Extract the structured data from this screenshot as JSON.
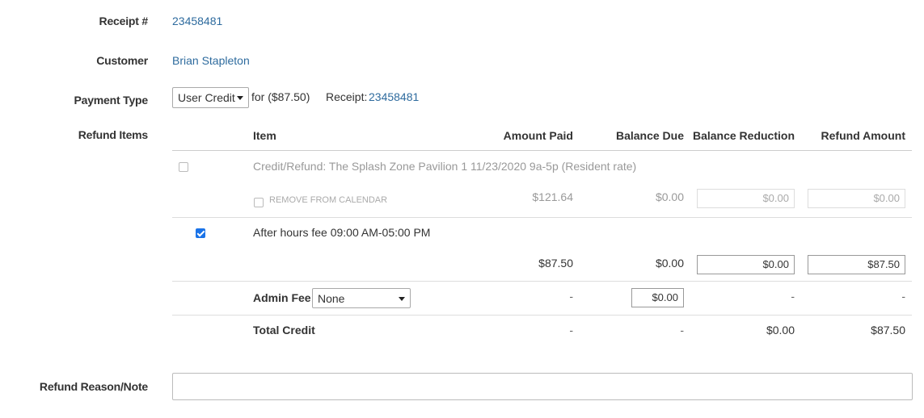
{
  "receipt": {
    "label": "Receipt #",
    "value": "23458481"
  },
  "customer": {
    "label": "Customer",
    "value": "Brian Stapleton"
  },
  "payment": {
    "label": "Payment Type",
    "type_selected": "User Credit",
    "for_text": "for ($87.50)",
    "receipt_label": "Receipt:",
    "receipt_link": "23458481"
  },
  "refund_items": {
    "label": "Refund Items",
    "columns": {
      "item": "Item",
      "amount_paid": "Amount Paid",
      "balance_due": "Balance Due",
      "balance_reduction": "Balance Reduction",
      "refund_amount": "Refund Amount"
    },
    "rows": [
      {
        "checked": false,
        "enabled": false,
        "name": "Credit/Refund: The Splash Zone Pavilion 1 11/23/2020 9a-5p (Resident rate)",
        "remove_label": "REMOVE FROM CALENDAR",
        "amount_paid": "$121.64",
        "balance_due": "$0.00",
        "balance_reduction": "$0.00",
        "refund_amount": "$0.00"
      },
      {
        "checked": true,
        "enabled": true,
        "name": "After hours fee 09:00 AM-05:00 PM",
        "amount_paid": "$87.50",
        "balance_due": "$0.00",
        "balance_reduction": "$0.00",
        "refund_amount": "$87.50"
      }
    ],
    "admin_fee": {
      "label": "Admin Fee:",
      "selected": "None",
      "amount_paid": "-",
      "balance_due": "$0.00",
      "balance_reduction": "-",
      "refund_amount": "-"
    },
    "total": {
      "label": "Total Credit",
      "amount_paid": "-",
      "balance_due": "-",
      "balance_reduction": "$0.00",
      "refund_amount": "$87.50"
    }
  },
  "refund_note": {
    "label": "Refund Reason/Note",
    "value": ""
  },
  "colors": {
    "link": "#2e6b9e",
    "checkbox_checked": "#1a73e8"
  },
  "icons": [
    "dropdown-caret-icon",
    "checkbox-checked-icon"
  ]
}
